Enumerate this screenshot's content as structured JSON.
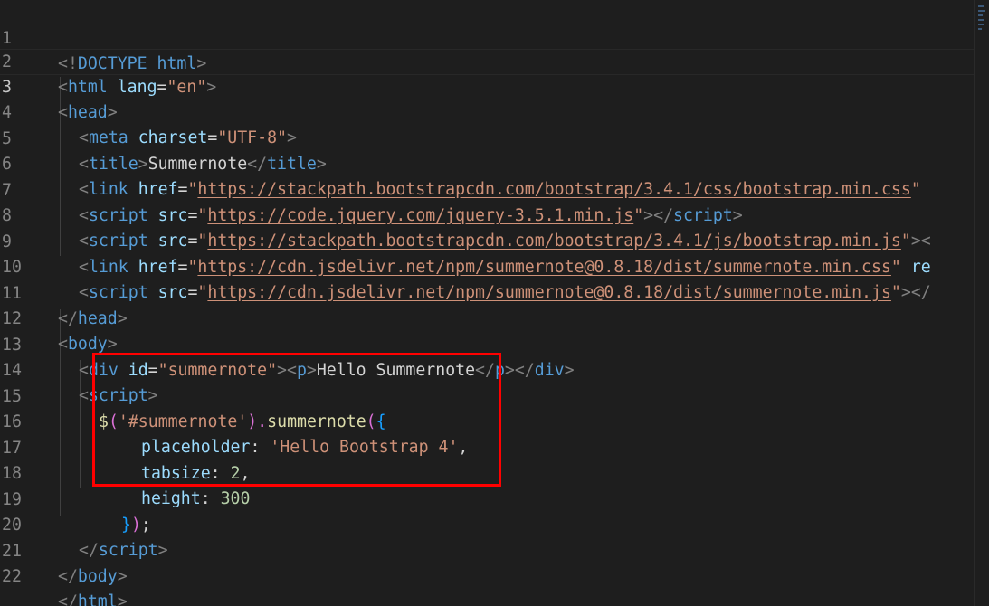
{
  "editor": {
    "lines": [
      {
        "n": "1"
      },
      {
        "n": "2"
      },
      {
        "n": "3"
      },
      {
        "n": "4"
      },
      {
        "n": "5"
      },
      {
        "n": "6"
      },
      {
        "n": "7"
      },
      {
        "n": "8"
      },
      {
        "n": "9"
      },
      {
        "n": "10"
      },
      {
        "n": "11"
      },
      {
        "n": "12"
      },
      {
        "n": "13"
      },
      {
        "n": "14"
      },
      {
        "n": "15"
      },
      {
        "n": "16"
      },
      {
        "n": "17"
      },
      {
        "n": "18"
      },
      {
        "n": "19"
      },
      {
        "n": "20"
      },
      {
        "n": "21"
      },
      {
        "n": "22"
      }
    ],
    "code": {
      "l1": {
        "a": "<!",
        "b": "DOCTYPE",
        "c": " html",
        "d": ">"
      },
      "l2": {
        "a": "<",
        "b": "html",
        "c": " lang",
        "d": "=",
        "e": "\"en\"",
        "f": ">"
      },
      "l3": {
        "a": "<",
        "b": "head",
        "c": ">"
      },
      "l4": {
        "a": "<",
        "b": "meta",
        "c": " charset",
        "d": "=",
        "e": "\"UTF-8\"",
        "f": ">"
      },
      "l5": {
        "a": "<",
        "b": "title",
        "c": ">",
        "d": "Summernote",
        "e": "</",
        "f": "title",
        "g": ">"
      },
      "l6": {
        "a": "<",
        "b": "link",
        "c": " href",
        "d": "=",
        "e": "\"",
        "f": "https://stackpath.bootstrapcdn.com/bootstrap/3.4.1/css/bootstrap.min.css",
        "g": "\""
      },
      "l7": {
        "a": "<",
        "b": "script",
        "c": " src",
        "d": "=",
        "e": "\"",
        "f": "https://code.jquery.com/jquery-3.5.1.min.js",
        "g": "\"",
        "h": "></",
        "i": "script",
        "j": ">"
      },
      "l8": {
        "a": "<",
        "b": "script",
        "c": " src",
        "d": "=",
        "e": "\"",
        "f": "https://stackpath.bootstrapcdn.com/bootstrap/3.4.1/js/bootstrap.min.js",
        "g": "\"",
        "h": "><"
      },
      "l9": {
        "a": "<",
        "b": "link",
        "c": " href",
        "d": "=",
        "e": "\"",
        "f": "https://cdn.jsdelivr.net/npm/summernote@0.8.18/dist/summernote.min.css",
        "g": "\"",
        "h": " re"
      },
      "l10": {
        "a": "<",
        "b": "script",
        "c": " src",
        "d": "=",
        "e": "\"",
        "f": "https://cdn.jsdelivr.net/npm/summernote@0.8.18/dist/summernote.min.js",
        "g": "\"",
        "h": "></"
      },
      "l11": {
        "a": "</",
        "b": "head",
        "c": ">"
      },
      "l12": {
        "a": "<",
        "b": "body",
        "c": ">"
      },
      "l13": {
        "a": "<",
        "b": "div",
        "c": " id",
        "d": "=",
        "e": "\"summernote\"",
        "f": "><",
        "g": "p",
        "h": ">",
        "i": "Hello Summernote",
        "j": "</",
        "k": "p",
        "l": "></",
        "m": "div",
        "n": ">"
      },
      "l14": {
        "a": "<",
        "b": "script",
        "c": ">"
      },
      "l15": {
        "a": "$",
        "b": "(",
        "c": "'#summernote'",
        "d": ").",
        "e": "summernote",
        "f": "(",
        "g": "{"
      },
      "l16": {
        "a": "placeholder",
        "b": ": ",
        "c": "'Hello Bootstrap 4'",
        "d": ","
      },
      "l17": {
        "a": "tabsize",
        "b": ": ",
        "c": "2",
        "d": ","
      },
      "l18": {
        "a": "height",
        "b": ": ",
        "c": "300"
      },
      "l19": {
        "a": "}",
        "b": ")",
        "c": ";"
      },
      "l20": {
        "a": "</",
        "b": "script",
        "c": ">"
      },
      "l21": {
        "a": "</",
        "b": "body",
        "c": ">"
      },
      "l22": {
        "a": "</",
        "b": "html",
        "c": ">"
      }
    },
    "colors": {
      "background": "#1e1e1e",
      "tag": "#569cd6",
      "attribute": "#9cdcfe",
      "string": "#ce9178",
      "function": "#dcdcaa",
      "number": "#b5cea8",
      "highlight_box": "#ff0000"
    }
  }
}
